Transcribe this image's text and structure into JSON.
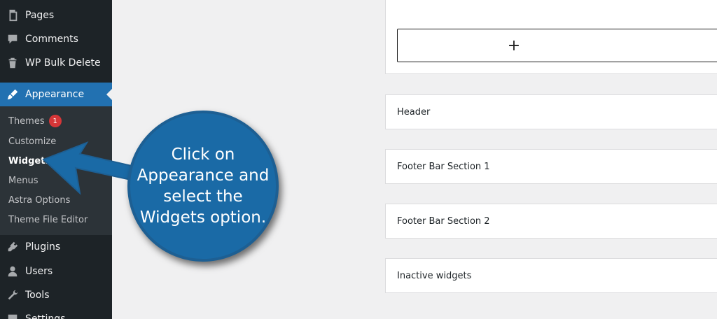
{
  "sidebar": {
    "items": [
      {
        "label": "Pages",
        "icon": "pages-icon"
      },
      {
        "label": "Comments",
        "icon": "comments-icon"
      },
      {
        "label": "WP Bulk Delete",
        "icon": "trash-icon"
      },
      {
        "label": "Appearance",
        "icon": "paintbrush-icon",
        "current": true
      },
      {
        "label": "Plugins",
        "icon": "plugin-icon"
      },
      {
        "label": "Users",
        "icon": "users-icon"
      },
      {
        "label": "Tools",
        "icon": "wrench-icon"
      },
      {
        "label": "Settings",
        "icon": "settings-icon"
      }
    ],
    "submenu": [
      {
        "label": "Themes",
        "badge": "1"
      },
      {
        "label": "Customize"
      },
      {
        "label": "Widgets",
        "current": true
      },
      {
        "label": "Menus"
      },
      {
        "label": "Astra Options"
      },
      {
        "label": "Theme File Editor"
      }
    ]
  },
  "editor": {
    "add_block_symbol": "+",
    "widget_areas": [
      "Header",
      "Footer Bar Section 1",
      "Footer Bar Section 2",
      "Inactive widgets"
    ]
  },
  "callout": {
    "text": "Click on Appearance and select the Widgets option."
  },
  "colors": {
    "sidebar_bg": "#1d2327",
    "accent": "#2271b1",
    "badge": "#d63638",
    "callout": "#1a6aa6"
  }
}
